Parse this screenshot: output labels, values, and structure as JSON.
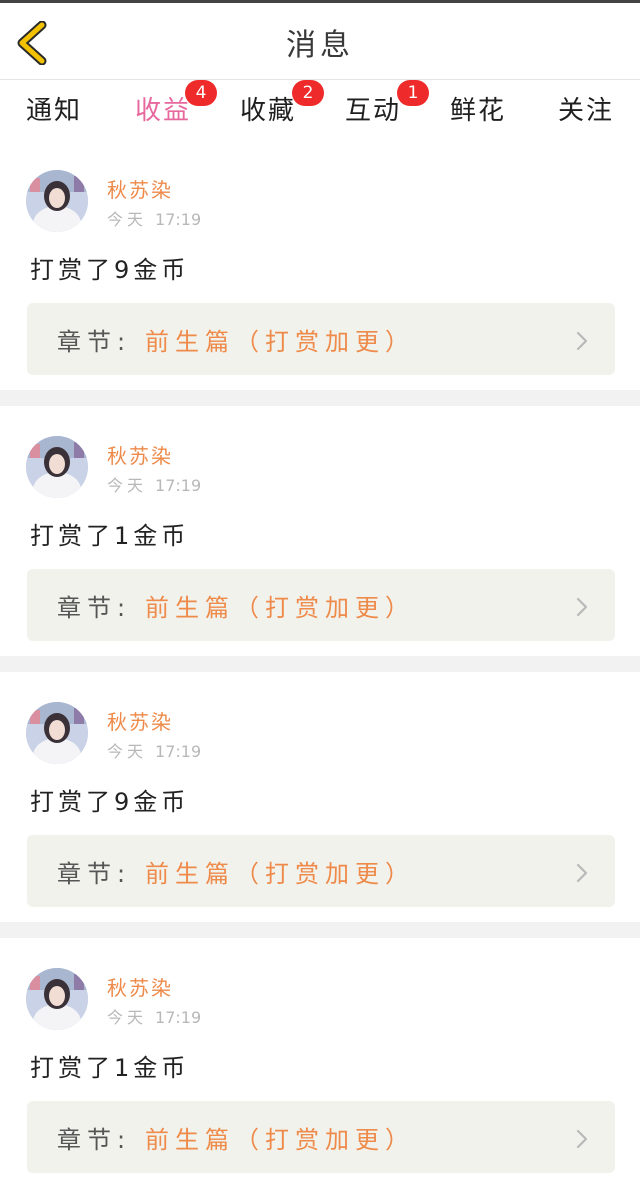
{
  "header": {
    "title": "消息"
  },
  "tabs": [
    {
      "label": "通知",
      "badge": ""
    },
    {
      "label": "收益",
      "badge": "4",
      "active": true
    },
    {
      "label": "收藏",
      "badge": "2"
    },
    {
      "label": "互动",
      "badge": "1"
    },
    {
      "label": "鲜花",
      "badge": ""
    },
    {
      "label": "关注",
      "badge": ""
    }
  ],
  "messages": [
    {
      "name": "秋苏染",
      "day": "今天",
      "time": "17:19",
      "text": "打赏了9金币",
      "chapter_label": "章节:",
      "chapter": "前生篇（打赏加更）"
    },
    {
      "name": "秋苏染",
      "day": "今天",
      "time": "17:19",
      "text": "打赏了1金币",
      "chapter_label": "章节:",
      "chapter": "前生篇（打赏加更）"
    },
    {
      "name": "秋苏染",
      "day": "今天",
      "time": "17:19",
      "text": "打赏了9金币",
      "chapter_label": "章节:",
      "chapter": "前生篇（打赏加更）"
    },
    {
      "name": "秋苏染",
      "day": "今天",
      "time": "17:19",
      "text": "打赏了1金币",
      "chapter_label": "章节:",
      "chapter": "前生篇（打赏加更）"
    }
  ],
  "colors": {
    "accent": "#e6689d",
    "badge": "#ee2a2a",
    "name": "#ee8a4a",
    "chapter_bg": "#f2f2ec",
    "back_icon": "#f2c200"
  }
}
